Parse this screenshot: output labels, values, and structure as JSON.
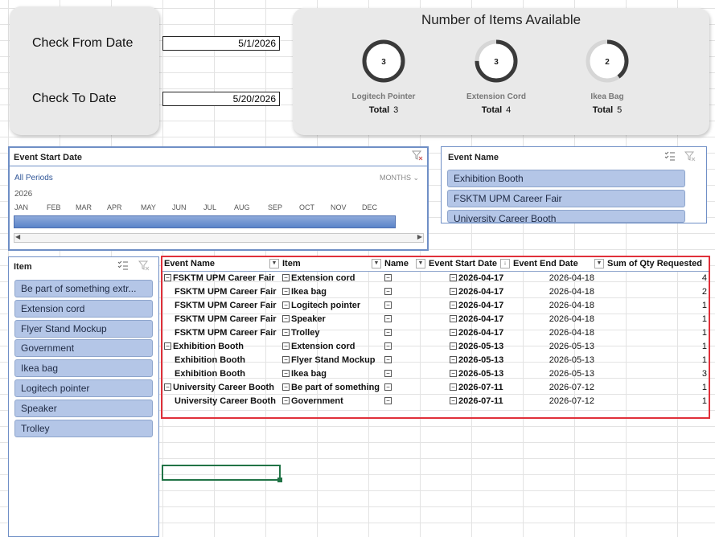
{
  "date_card": {
    "from_label": "Check From Date",
    "from_value": "5/1/2026",
    "to_label": "Check To Date",
    "to_value": "5/20/2026"
  },
  "items_card": {
    "title": "Number of Items Available",
    "gauges": [
      {
        "value": "3",
        "name": "Logitech Pointer",
        "total_label": "Total",
        "total": "3",
        "fraction": 1.0
      },
      {
        "value": "3",
        "name": "Extension Cord",
        "total_label": "Total",
        "total": "4",
        "fraction": 0.75
      },
      {
        "value": "2",
        "name": "Ikea Bag",
        "total_label": "Total",
        "total": "5",
        "fraction": 0.4
      }
    ]
  },
  "timeline": {
    "title": "Event Start Date",
    "period_link": "All Periods",
    "unit": "MONTHS",
    "year": "2026",
    "months": [
      "JAN",
      "FEB",
      "MAR",
      "APR",
      "MAY",
      "JUN",
      "JUL",
      "AUG",
      "SEP",
      "OCT",
      "NOV",
      "DEC"
    ]
  },
  "event_slicer": {
    "title": "Event Name",
    "items": [
      "Exhibition Booth",
      "FSKTM UPM Career Fair",
      "University Career Booth"
    ]
  },
  "item_slicer": {
    "title": "Item",
    "items": [
      "Be part of something extr...",
      "Extension cord",
      "Flyer Stand Mockup",
      "Government",
      "Ikea bag",
      "Logitech pointer",
      "Speaker",
      "Trolley"
    ]
  },
  "pivot": {
    "headers": [
      "Event Name",
      "Item",
      "Name",
      "Event Start Date",
      "Event End Date",
      "Sum of Qty Requested"
    ],
    "rows": [
      {
        "event": "FSKTM UPM Career Fair",
        "event_minus": true,
        "item": "Extension cord",
        "start": "2026-04-17",
        "end": "2026-04-18",
        "qty": "4"
      },
      {
        "event": "FSKTM UPM Career Fair",
        "event_minus": false,
        "item": "Ikea bag",
        "start": "2026-04-17",
        "end": "2026-04-18",
        "qty": "2"
      },
      {
        "event": "FSKTM UPM Career Fair",
        "event_minus": false,
        "item": "Logitech pointer",
        "start": "2026-04-17",
        "end": "2026-04-18",
        "qty": "1"
      },
      {
        "event": "FSKTM UPM Career Fair",
        "event_minus": false,
        "item": "Speaker",
        "start": "2026-04-17",
        "end": "2026-04-18",
        "qty": "1"
      },
      {
        "event": "FSKTM UPM Career Fair",
        "event_minus": false,
        "item": "Trolley",
        "start": "2026-04-17",
        "end": "2026-04-18",
        "qty": "1"
      },
      {
        "event": "Exhibition Booth",
        "event_minus": true,
        "item": "Extension cord",
        "start": "2026-05-13",
        "end": "2026-05-13",
        "qty": "1"
      },
      {
        "event": "Exhibition Booth",
        "event_minus": false,
        "item": "Flyer Stand Mockup",
        "start": "2026-05-13",
        "end": "2026-05-13",
        "qty": "1"
      },
      {
        "event": "Exhibition Booth",
        "event_minus": false,
        "item": "Ikea bag",
        "start": "2026-05-13",
        "end": "2026-05-13",
        "qty": "3"
      },
      {
        "event": "University Career Booth",
        "event_minus": true,
        "item": "Be part of something",
        "start": "2026-07-11",
        "end": "2026-07-12",
        "qty": "1"
      },
      {
        "event": "University Career Booth",
        "event_minus": false,
        "item": "Government",
        "start": "2026-07-11",
        "end": "2026-07-12",
        "qty": "1"
      }
    ]
  },
  "colors": {
    "gauge_fill": "#3a3a3a",
    "gauge_track": "#d6d6d6",
    "slicer_button": "#b4c6e7",
    "pivot_border": "#e0303a",
    "selection": "#217346"
  }
}
